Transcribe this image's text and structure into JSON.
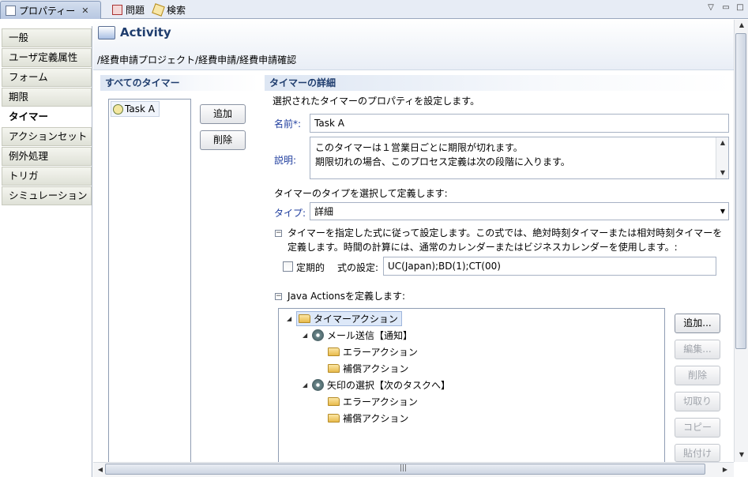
{
  "tabs": [
    {
      "label": "プロパティー",
      "active": true
    },
    {
      "label": "問題",
      "active": false
    },
    {
      "label": "検索",
      "active": false
    }
  ],
  "tab_close": "✕",
  "nav": [
    {
      "label": "一般"
    },
    {
      "label": "ユーザ定義属性"
    },
    {
      "label": "フォーム"
    },
    {
      "label": "期限"
    },
    {
      "label": "タイマー",
      "selected": true
    },
    {
      "label": "アクションセット"
    },
    {
      "label": "例外処理"
    },
    {
      "label": "トリガ"
    },
    {
      "label": "シミュレーション"
    }
  ],
  "header": {
    "title": "Activity",
    "breadcrumb": "/経費申請プロジェクト/経費申請/経費申請確認"
  },
  "timers": {
    "section_title": "すべてのタイマー",
    "items": [
      "Task A"
    ],
    "add_label": "追加",
    "delete_label": "削除"
  },
  "details": {
    "section_title": "タイマーの詳細",
    "intro": "選択されたタイマーのプロパティを設定します。",
    "name_label": "名前*:",
    "name_value": "Task A",
    "desc_label": "説明:",
    "desc_line1": "このタイマーは１営業日ごとに期限が切れます。",
    "desc_line2": "期限切れの場合、このプロセス定義は次の段階に入ります。",
    "type_intro": "タイマーのタイプを選択して定義します:",
    "type_label": "タイプ:",
    "type_value": "詳細",
    "expr_desc1": "タイマーを指定した式に従って設定します。この式では、絶対時刻タイマーまたは相対時刻タイマーを",
    "expr_desc2": "定義します。時間の計算には、通常のカレンダーまたはビジネスカレンダーを使用します。:",
    "periodic_label": "定期的",
    "expr_label": "式の設定:",
    "expr_value": "UC(Japan);BD(1);CT(00)",
    "java_actions_label": "Java Actionsを定義します:"
  },
  "tree": [
    {
      "label": "タイマーアクション",
      "icon": "folder-icon",
      "level": 0,
      "selected": true,
      "expanded": true
    },
    {
      "label": "メール送信【通知】",
      "icon": "gear-icon",
      "level": 1,
      "expanded": true
    },
    {
      "label": "エラーアクション",
      "icon": "folder-icon",
      "level": 2
    },
    {
      "label": "補償アクション",
      "icon": "folder-icon",
      "level": 2
    },
    {
      "label": "矢印の選択【次のタスクへ】",
      "icon": "gear-icon",
      "level": 1,
      "expanded": true
    },
    {
      "label": "エラーアクション",
      "icon": "folder-icon",
      "level": 2
    },
    {
      "label": "補償アクション",
      "icon": "folder-icon",
      "level": 2
    }
  ],
  "action_buttons": [
    {
      "label": "追加...",
      "enabled": true
    },
    {
      "label": "編集...",
      "enabled": false
    },
    {
      "label": "削除",
      "enabled": false
    },
    {
      "label": "切取り",
      "enabled": false
    },
    {
      "label": "コピー",
      "enabled": false
    },
    {
      "label": "貼付け",
      "enabled": false
    }
  ],
  "scroll_grip": "|||"
}
